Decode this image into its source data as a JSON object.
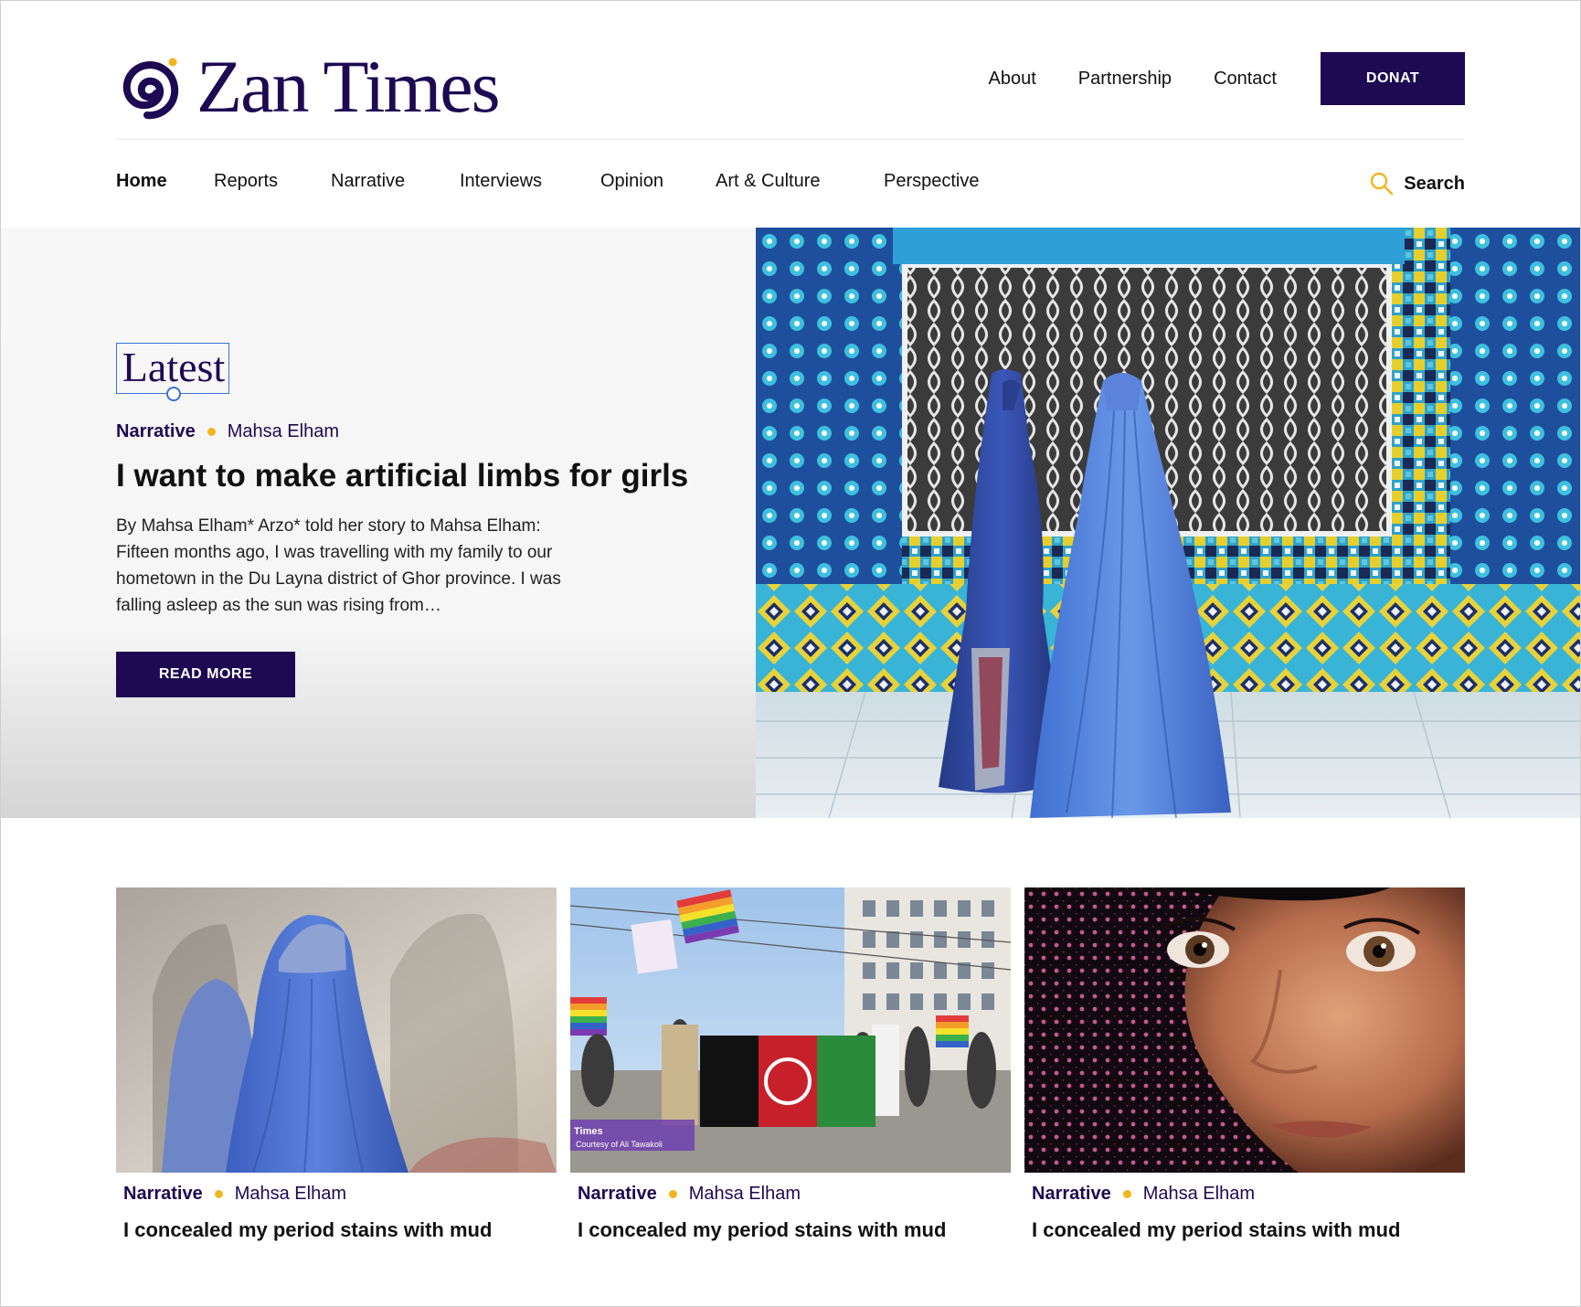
{
  "brand": {
    "name": "Zan Times",
    "color": "#1d0a52",
    "accent": "#f2b51d"
  },
  "top_links": [
    "About",
    "Partnership",
    "Contact"
  ],
  "donate_label": "DONAT",
  "nav": {
    "items": [
      "Home",
      "Reports",
      "Narrative",
      "Interviews",
      "Opinion",
      "Art & Culture",
      "Perspective"
    ],
    "active": "Home",
    "search_label": "Search"
  },
  "hero": {
    "section_label": "Latest",
    "category": "Narrative",
    "author": "Mahsa Elham",
    "title": "I want to make artificial limbs for girls",
    "excerpt": "By Mahsa Elham*  Arzo* told her story to Mahsa Elham: Fifteen months ago, I was travelling with my family to our hometown in the Du Layna district of Ghor province. I was falling asleep as the sun was rising from…",
    "cta": "READ MORE",
    "image_icon": "burqa-women-tiled-wall-photo"
  },
  "cards": [
    {
      "category": "Narrative",
      "author": "Mahsa Elham",
      "title": "I concealed my period stains with mud",
      "image_icon": "blue-burqa-photo"
    },
    {
      "category": "Narrative",
      "author": "Mahsa Elham",
      "title": "I concealed my period stains with mud",
      "image_icon": "pride-march-afghan-flag-photo",
      "image_caption_brand": "Times",
      "image_caption": "Courtesy of Ali Tawakoli"
    },
    {
      "category": "Narrative",
      "author": "Mahsa Elham",
      "title": "I concealed my period stains with mud",
      "image_icon": "veiled-woman-face-photo"
    }
  ]
}
